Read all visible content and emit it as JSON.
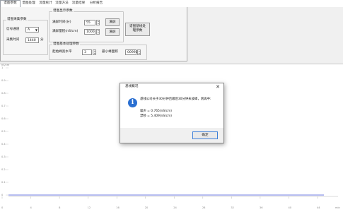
{
  "tabs": [
    "谱图参数",
    "谱图处理",
    "流量统计",
    "流量方法",
    "流量结果",
    "分析报告"
  ],
  "sample_group": {
    "title": "谱图采集参数",
    "channel_label": "信号通道",
    "channel_value": "A",
    "time_label": "采集时间",
    "time_value": "1440",
    "time_unit": "分"
  },
  "display_group": {
    "title": "谱图显示参数",
    "full_time_label": "满屏时间(分)",
    "full_time_value": "55",
    "full_range_label": "满屏量程(nS/cm)",
    "full_range_value": "1000",
    "full_screen_button": "满屏",
    "auto_scale_button": "满屏"
  },
  "baseline_button": "谱图基线处理参数",
  "basic_group": {
    "title": "谱图基本处理参数",
    "smooth_label": "起始峰宽水平",
    "smooth_value": "3",
    "min_area_label": "最小峰面积",
    "min_area_value": "00990"
  },
  "plot": {
    "y_unit": "nS/cm",
    "y_ticks": [
      "1",
      "0.9",
      "0.8",
      "0.7",
      "0.6",
      "0.5",
      "0.4",
      "0.3",
      "0.2",
      "0.1",
      "0"
    ],
    "x_ticks": [
      "0",
      "4",
      "8",
      "12",
      "16",
      "20",
      "24",
      "28",
      "32",
      "36",
      "40",
      "44"
    ],
    "x_unit": "min",
    "line_color": "#3d4fd8"
  },
  "dialog": {
    "title": "基线概况",
    "message": "基线公司长于30分钟且最后30分钟未波峰，则再中:",
    "noise": "噪声 = 0.765(nS/cm)",
    "drift": "漂移 = 5.409(nS/cm)",
    "ok_button": "确定"
  }
}
